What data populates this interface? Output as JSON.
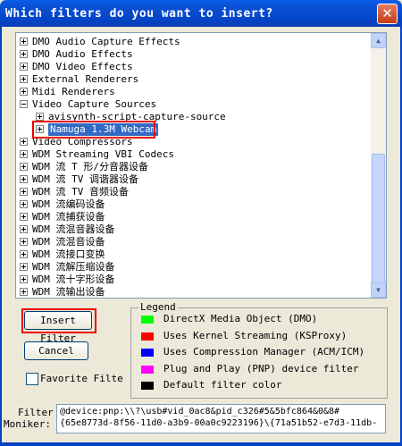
{
  "window": {
    "title": "Which filters do you want to insert?",
    "close_glyph": "✕"
  },
  "tree": {
    "top_items": [
      "DMO Audio Capture Effects",
      "DMO Audio Effects",
      "DMO Video Effects",
      "External Renderers",
      "Midi Renderers"
    ],
    "expanded": "Video Capture Sources",
    "children": [
      "avisynth-script-capture-source",
      "Namuga 1.3M Webcam"
    ],
    "after_items": [
      "Video Compressors",
      "WDM Streaming VBI Codecs",
      "WDM 流 T 形/分音器设备",
      "WDM 流 TV 调谐器设备",
      "WDM 流 TV 音频设备",
      "WDM 流编码设备",
      "WDM 流捕获设备",
      "WDM 流混音器设备",
      "WDM 流混音设备",
      "WDM 流接口变换",
      "WDM 流解压缩设备",
      "WDM 流十字形设备",
      "WDM 流输出设备"
    ]
  },
  "buttons": {
    "insert": "Insert Filter",
    "cancel": "Cancel"
  },
  "favorite": {
    "label": "Favorite Filte",
    "checked": false
  },
  "legend": {
    "title": "Legend",
    "items": [
      {
        "label": "DirectX Media Object (DMO)",
        "color": "#00ff00"
      },
      {
        "label": "Uses Kernel Streaming (KSProxy)",
        "color": "#ff0000"
      },
      {
        "label": "Uses Compression Manager (ACM/ICM)",
        "color": "#0000ff"
      },
      {
        "label": "Plug and Play (PNP) device filter",
        "color": "#ff00ff"
      },
      {
        "label": "Default filter color",
        "color": "#000000"
      }
    ]
  },
  "moniker": {
    "label_filter": "Filter",
    "label_moniker": "Moniker:",
    "line1": "@device:pnp:\\\\?\\usb#vid_0ac8&pid_c326#5&5bfc864&0&8#",
    "line2": "{65e8773d-8f56-11d0-a3b9-00a0c9223196}\\{71a51b52-e7d3-11db-"
  },
  "colors": {
    "selection": "#316ac5",
    "highlight": "#ee0000"
  }
}
